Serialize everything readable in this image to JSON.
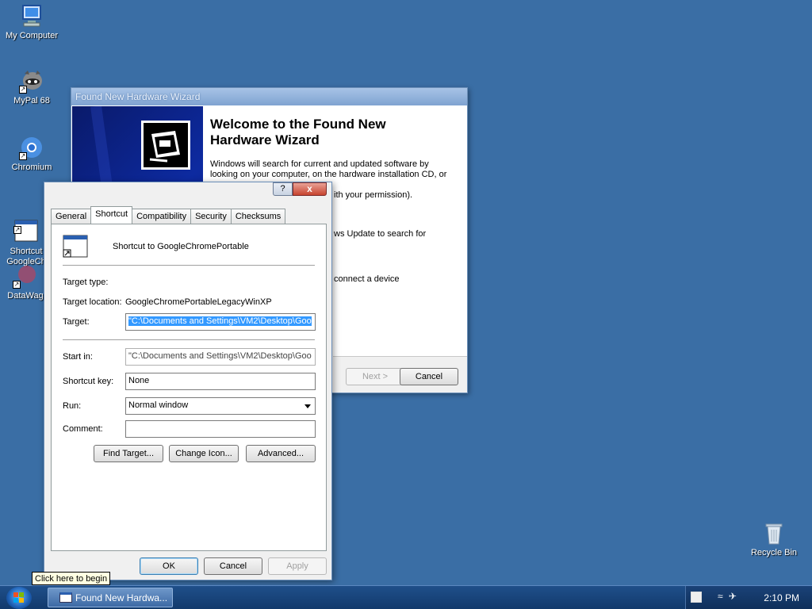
{
  "desktop": {
    "icons": [
      {
        "label": "My Computer"
      },
      {
        "label": "MyPal 68"
      },
      {
        "label": "Chromium"
      },
      {
        "label": "Shortcut to GoogleChromePortable",
        "display": "Shortcut\nGoogleCh"
      },
      {
        "label": "DataWag"
      },
      {
        "label": "Recycle Bin"
      }
    ]
  },
  "wizard": {
    "title": "Found New Hardware Wizard",
    "heading": "Welcome to the Found New Hardware Wizard",
    "paragraph": "Windows will search for current and updated software by looking on your computer, on the hardware installation CD, or on",
    "paragraph_tail": "ith your permission).",
    "fragment_update": "ws Update to search for",
    "fragment_connect": "connect a device",
    "next_label": "Next >",
    "cancel_label": "Cancel"
  },
  "props": {
    "help_glyph": "?",
    "close_glyph": "x",
    "tabs": [
      "General",
      "Shortcut",
      "Compatibility",
      "Security",
      "Checksums"
    ],
    "active_tab": "Shortcut",
    "shortcut_name": "Shortcut to GoogleChromePortable",
    "target_type_label": "Target type:",
    "target_type_value": "",
    "target_location_label": "Target location:",
    "target_location_value": "GoogleChromePortableLegacyWinXP",
    "target_label": "Target:",
    "target_value": "\"C:\\Documents and Settings\\VM2\\Desktop\\Goo",
    "start_in_label": "Start in:",
    "start_in_value": "\"C:\\Documents and Settings\\VM2\\Desktop\\Goo",
    "shortcut_key_label": "Shortcut key:",
    "shortcut_key_value": "None",
    "run_label": "Run:",
    "run_value": "Normal window",
    "comment_label": "Comment:",
    "comment_value": "",
    "find_target_label": "Find Target...",
    "change_icon_label": "Change Icon...",
    "advanced_label": "Advanced...",
    "ok_label": "OK",
    "cancel_label": "Cancel",
    "apply_label": "Apply"
  },
  "taskbar": {
    "task_label": "Found New Hardwa...",
    "tooltip": "Click here to begin",
    "clock": "2:10 PM"
  },
  "colors": {
    "desktop": "#3a6ea5",
    "selection": "#3399ff"
  }
}
